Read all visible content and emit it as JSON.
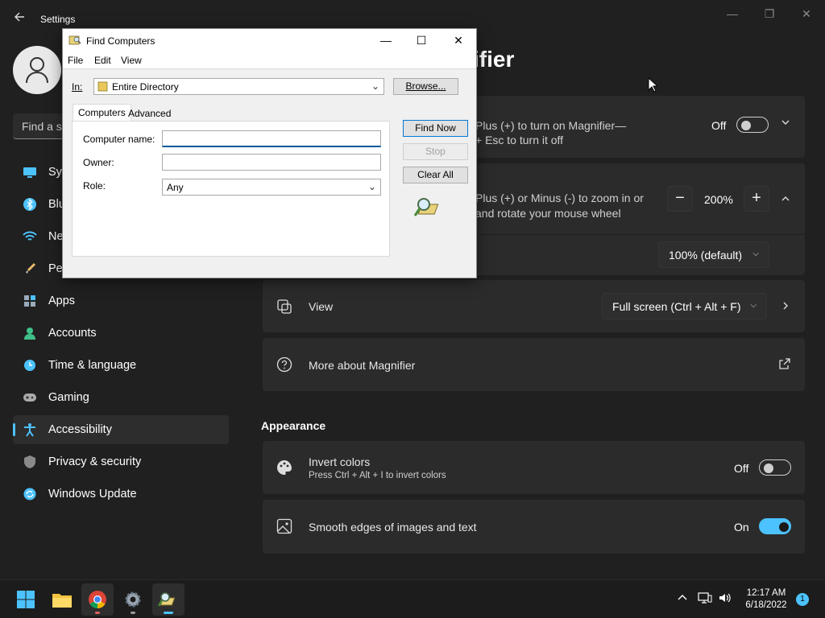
{
  "settings": {
    "window_title": "Settings",
    "search_placeholder": "Find a se",
    "page_title": "ifier",
    "nav": [
      {
        "label": "Sys",
        "icon": "system-icon"
      },
      {
        "label": "Blu",
        "icon": "bluetooth-icon"
      },
      {
        "label": "Ne",
        "icon": "network-icon"
      },
      {
        "label": "Pe",
        "icon": "personalization-icon"
      },
      {
        "label": "Apps",
        "icon": "apps-icon"
      },
      {
        "label": "Accounts",
        "icon": "accounts-icon"
      },
      {
        "label": "Time & language",
        "icon": "time-language-icon"
      },
      {
        "label": "Gaming",
        "icon": "gaming-icon"
      },
      {
        "label": "Accessibility",
        "icon": "accessibility-icon"
      },
      {
        "label": "Privacy & security",
        "icon": "privacy-icon"
      },
      {
        "label": "Windows Update",
        "icon": "windows-update-icon"
      }
    ],
    "magnifier_shortcut": {
      "line1": "Plus (+) to turn on Magnifier—",
      "line2": "+ Esc to turn it off",
      "toggle_label": "Off",
      "toggle_on": false
    },
    "zoom_level": {
      "line1": "Plus (+) or Minus (-) to zoom in or",
      "line2": "and rotate your mouse wheel",
      "value": "200%",
      "minus": "−",
      "plus": "+"
    },
    "zoom_increment": {
      "value": "100% (default)"
    },
    "view": {
      "label": "View",
      "value": "Full screen (Ctrl + Alt + F)"
    },
    "more_about": {
      "label": "More about Magnifier"
    },
    "appearance_header": "Appearance",
    "invert_colors": {
      "label": "Invert colors",
      "sub": "Press Ctrl + Alt + I to invert colors",
      "toggle_label": "Off",
      "toggle_on": false
    },
    "smooth_edges": {
      "label": "Smooth edges of images and text",
      "toggle_label": "On",
      "toggle_on": true
    }
  },
  "dialog": {
    "title": "Find Computers",
    "menu": [
      "File",
      "Edit",
      "View"
    ],
    "in_label": "In:",
    "in_value": "Entire Directory",
    "browse": "Browse...",
    "tabs": [
      "Computers",
      "Advanced"
    ],
    "fields": {
      "computer_name": "Computer name:",
      "owner": "Owner:",
      "role": "Role:",
      "role_value": "Any"
    },
    "buttons": {
      "find_now": "Find Now",
      "stop": "Stop",
      "clear_all": "Clear All"
    }
  },
  "taskbar": {
    "time": "12:17 AM",
    "date": "6/18/2022",
    "notifications": "1"
  },
  "colors": {
    "accent": "#4cc2ff",
    "background": "#202020",
    "card": "#2b2b2b"
  }
}
